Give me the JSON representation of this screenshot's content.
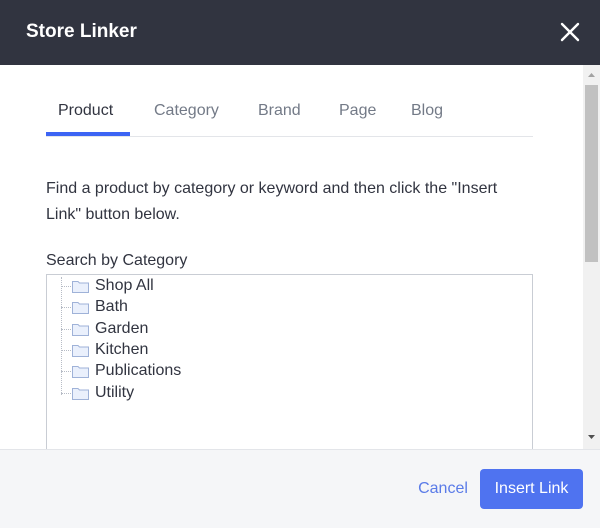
{
  "dialog": {
    "title": "Store Linker",
    "close_icon": "close-icon"
  },
  "tabs": [
    {
      "label": "Product",
      "active": true
    },
    {
      "label": "Category",
      "active": false
    },
    {
      "label": "Brand",
      "active": false
    },
    {
      "label": "Page",
      "active": false
    },
    {
      "label": "Blog",
      "active": false
    }
  ],
  "instructions": "Find a product by category or keyword and then click the \"Insert Link\" button below.",
  "search": {
    "label": "Search by Category",
    "categories": [
      {
        "label": "Shop All",
        "icon": "folder-icon"
      },
      {
        "label": "Bath",
        "icon": "folder-icon"
      },
      {
        "label": "Garden",
        "icon": "folder-icon"
      },
      {
        "label": "Kitchen",
        "icon": "folder-icon"
      },
      {
        "label": "Publications",
        "icon": "folder-icon"
      },
      {
        "label": "Utility",
        "icon": "folder-icon"
      }
    ]
  },
  "footer": {
    "cancel_label": "Cancel",
    "insert_label": "Insert Link"
  },
  "colors": {
    "header_bg": "#313440",
    "accent": "#3c64f4",
    "primary_button": "#4f73f0",
    "link": "#5a7be8"
  }
}
